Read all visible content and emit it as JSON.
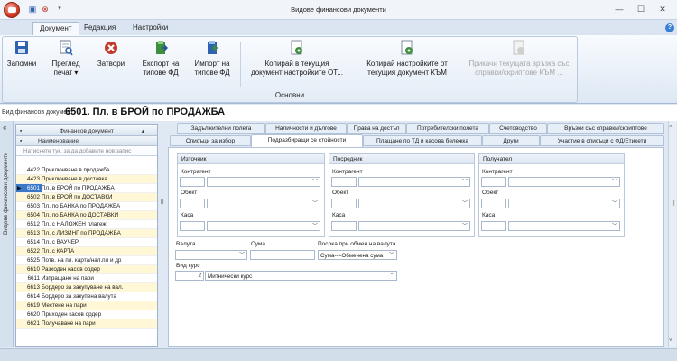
{
  "window": {
    "title": "Видове финансови документи"
  },
  "ribbon_tabs": [
    "Документ",
    "Редакция",
    "Настройки"
  ],
  "ribbon": {
    "group_label": "Основни",
    "buttons": [
      {
        "line1": "Запомни",
        "line2": ""
      },
      {
        "line1": "Преглед",
        "line2": "печат ▾"
      },
      {
        "line1": "Затвори",
        "line2": ""
      },
      {
        "line1": "Експорт на",
        "line2": "типове ФД"
      },
      {
        "line1": "Импорт на",
        "line2": "типове ФД"
      },
      {
        "line1": "Копирай в текущия",
        "line2": "документ настройките ОТ..."
      },
      {
        "line1": "Копирай настройките от",
        "line2": "текущия документ КЪМ"
      },
      {
        "line1": "Прикачи текущата връзка със",
        "line2": "справки/скриптове КЪМ ..."
      }
    ]
  },
  "doc": {
    "label": "Вид финансов документ:",
    "title": "6501. Пл. в БРОЙ по ПРОДАЖБА"
  },
  "left_strip": {
    "text": "Видове финансови документи"
  },
  "grid": {
    "group_header": "Финансов документ",
    "column_header": "Наименование",
    "filter_placeholder": "Натиснете тук, за да добавите нов запис",
    "rows": [
      {
        "code": "4422",
        "name": "Приключване в продажба"
      },
      {
        "code": "4423",
        "name": "Приключване в доставка"
      },
      {
        "code": "6501",
        "name": "Пл. в БРОЙ по ПРОДАЖБА"
      },
      {
        "code": "6502",
        "name": "Пл. в БРОЙ по ДОСТАВКИ"
      },
      {
        "code": "6503",
        "name": "Пл. по БАНКА по ПРОДАЖБА"
      },
      {
        "code": "6504",
        "name": "Пл. по БАНКА по ДОСТАВКИ"
      },
      {
        "code": "6512",
        "name": "Пл. с НАЛОЖЕН платеж"
      },
      {
        "code": "6513",
        "name": "Пл. с ЛИЗИНГ по ПРОДАЖБА"
      },
      {
        "code": "6514",
        "name": "Пл. с ВАУЧЕР"
      },
      {
        "code": "6522",
        "name": "Пл. с КАРТА"
      },
      {
        "code": "6525",
        "name": "Потв. на пл. карта/нал.пл и др"
      },
      {
        "code": "6610",
        "name": "Разходен касов ордер"
      },
      {
        "code": "6611",
        "name": "Изпращане на пари"
      },
      {
        "code": "6613",
        "name": "Бордеро за закупуване на вал."
      },
      {
        "code": "6614",
        "name": "Бордеро за закупена валута"
      },
      {
        "code": "6619",
        "name": "Местене на пари"
      },
      {
        "code": "6620",
        "name": "Приходен касов ордер"
      },
      {
        "code": "6621",
        "name": "Получаване на пари"
      }
    ]
  },
  "tabs_row1": [
    "Задължителни полета",
    "Наличности и дългове",
    "Права на достъп",
    "Потребителски полета",
    "Счетоводство",
    "Връзки със справки/скриптове"
  ],
  "tabs_row2": [
    "Списъци за избор",
    "Подразбиращи се стойности",
    "Плащане по ТД и касова бележка",
    "Други",
    "Участие в списъци с ФД/Етикети"
  ],
  "form": {
    "groups": [
      {
        "title": "Източник",
        "contractor": "Контрагент",
        "object": "Обект",
        "cashbox": "Каса"
      },
      {
        "title": "Посредник",
        "contractor": "Контрагент",
        "object": "Обект",
        "cashbox": "Каса"
      },
      {
        "title": "Получател",
        "contractor": "Контрагент",
        "object": "Обект",
        "cashbox": "Каса"
      }
    ],
    "currency_label": "Валута",
    "amount_label": "Сума",
    "exchange_label": "Посока при обмен на валута",
    "exchange_value": "Сума-->Обменена сума",
    "rate_type_label": "Вид курс",
    "rate_type_code": "2",
    "rate_type_value": "Митнически курс"
  }
}
